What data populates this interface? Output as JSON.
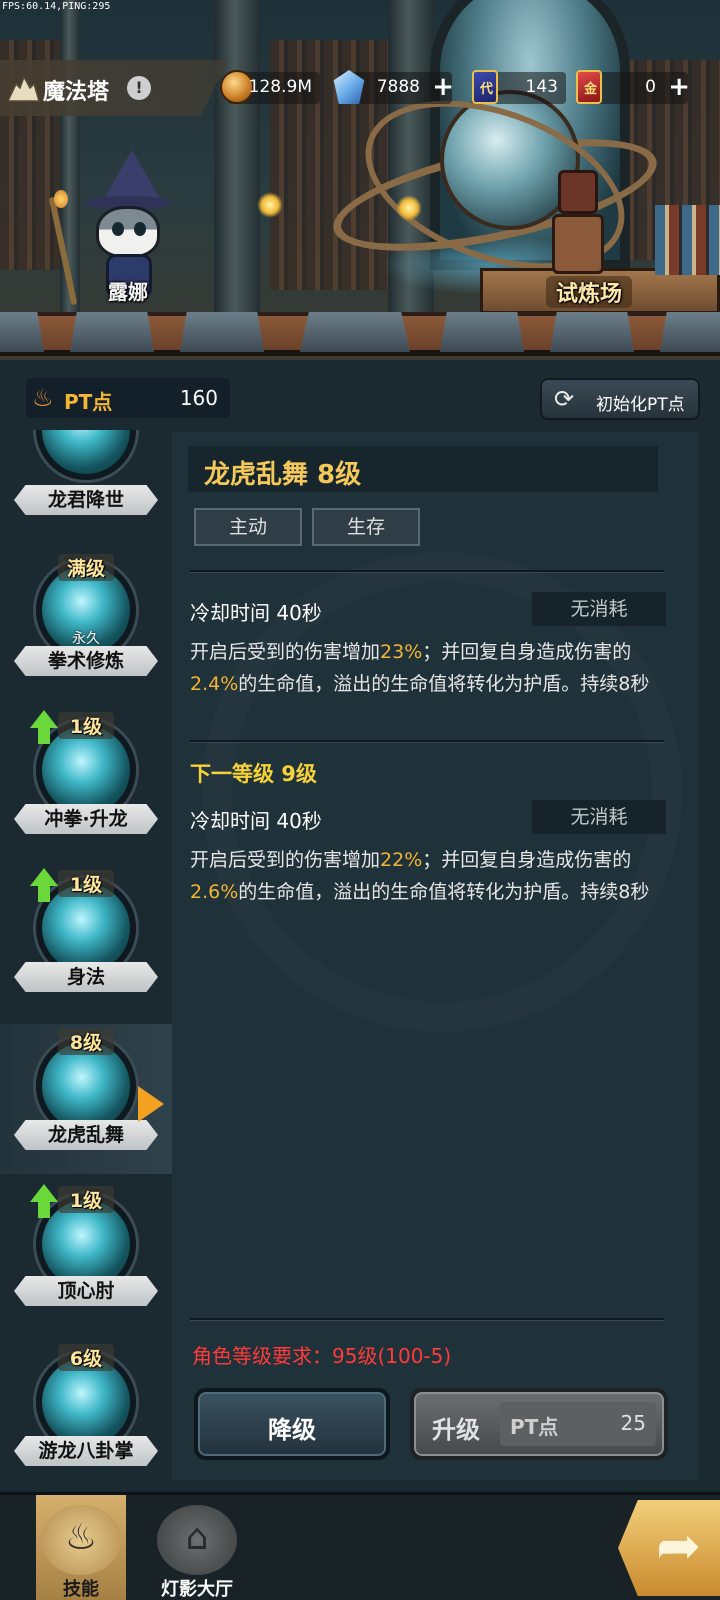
{
  "debug": {
    "fps": "FPS:60.14,PING:295"
  },
  "location": {
    "title": "魔法塔",
    "info_icon": "!"
  },
  "resources": [
    {
      "icon": "gold-coin-icon",
      "value": "128.9M",
      "has_plus": false
    },
    {
      "icon": "crystal-icon",
      "value": "7888",
      "has_plus": true
    },
    {
      "icon": "blue-card-icon",
      "glyph": "代",
      "value": "143",
      "has_plus": false
    },
    {
      "icon": "red-card-icon",
      "glyph": "金",
      "value": "0",
      "has_plus": true
    }
  ],
  "scene": {
    "npc_left": "露娜",
    "npc_right": "试炼场"
  },
  "pt": {
    "label": "PT点",
    "value": "160"
  },
  "reset_button": {
    "label": "初始化PT点"
  },
  "skills": [
    {
      "name": "龙君降世",
      "level": "",
      "upgradable": false,
      "note": ""
    },
    {
      "name": "拳术修炼",
      "level": "满级",
      "upgradable": false,
      "note": "永久"
    },
    {
      "name": "冲拳·升龙",
      "level": "1级",
      "upgradable": true,
      "note": ""
    },
    {
      "name": "身法",
      "level": "1级",
      "upgradable": true,
      "note": ""
    },
    {
      "name": "龙虎乱舞",
      "level": "8级",
      "upgradable": false,
      "note": "",
      "selected": true
    },
    {
      "name": "顶心肘",
      "level": "1级",
      "upgradable": true,
      "note": ""
    },
    {
      "name": "游龙八卦掌",
      "level": "6级",
      "upgradable": false,
      "note": ""
    }
  ],
  "detail": {
    "title": "龙虎乱舞 8级",
    "tags": [
      "主动",
      "生存"
    ],
    "current": {
      "cooldown": "冷却时间 40秒",
      "cost": "无消耗",
      "desc_parts": [
        "开启后受到的伤害增加",
        "23%",
        "；并回复自身造成伤害的",
        "2.4%",
        "的生命值，溢出的生命值将转化为护盾。持续8秒"
      ]
    },
    "next_title": "下一等级 9级",
    "next": {
      "cooldown": "冷却时间 40秒",
      "cost": "无消耗",
      "desc_parts": [
        "开启后受到的伤害增加",
        "22%",
        "；并回复自身造成伤害的",
        "2.6%",
        "的生命值，溢出的生命值将转化为护盾。持续8秒"
      ]
    },
    "requirement": "角色等级要求：95级(100-5)"
  },
  "buttons": {
    "downgrade": "降级",
    "upgrade": "升级",
    "upgrade_pt_label": "PT点",
    "upgrade_pt_cost": "25"
  },
  "nav": [
    {
      "label": "技能",
      "icon": "skill-book-icon",
      "active": true
    },
    {
      "label": "灯影大厅",
      "icon": "shadow-hall-icon",
      "active": false
    }
  ],
  "colors": {
    "accent_gold": "#f5b534",
    "title_gold": "#f5c85a",
    "warning_red": "#ff3a3a",
    "next_level_yellow": "#f6d13a"
  }
}
